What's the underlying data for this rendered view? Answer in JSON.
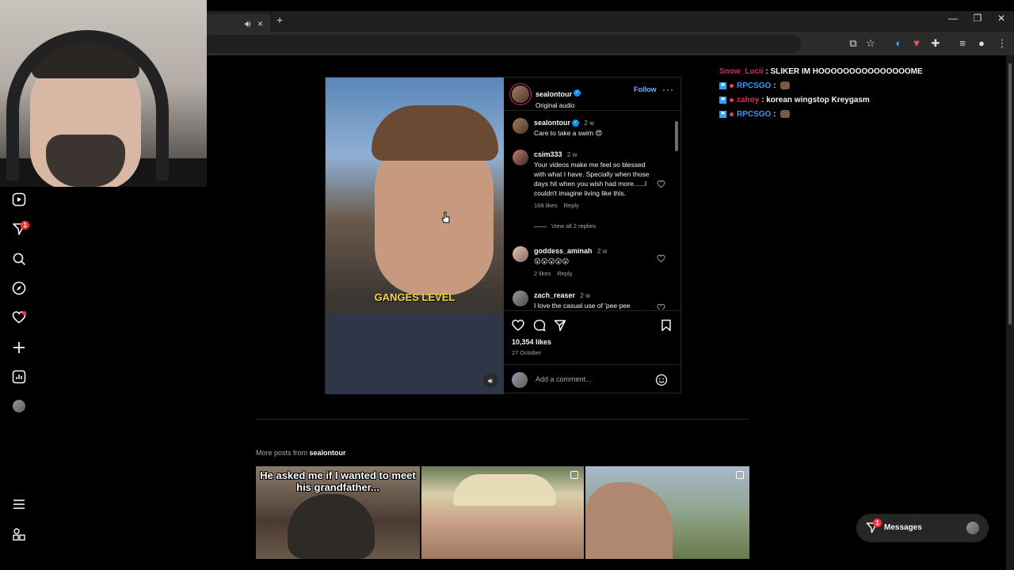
{
  "browser": {
    "new_tab": "+",
    "tab_close": "×",
    "window_controls": {
      "minimize": "—",
      "restore": "❐",
      "close": "✕"
    }
  },
  "post": {
    "username": "sealontour",
    "audio": "Original audio",
    "follow_label": "Follow",
    "video_caption": "GANGES LEVEL",
    "likes": "10,354 likes",
    "date": "27 October",
    "add_comment_placeholder": "Add a comment...",
    "comments": [
      {
        "user": "sealontour",
        "age": "2 w",
        "text": "Care to take a swim 😍",
        "verified": true
      },
      {
        "user": "csim333",
        "age": "2 w",
        "text": "Your videos make me feel so blessed with what I have. Specially when those days hit when you wish had more......I couldn't imagine living like this.",
        "likes": "168 likes",
        "reply": "Reply",
        "view_replies": "View all 2 replies"
      },
      {
        "user": "goddess_aminah",
        "age": "2 w",
        "text": "😮😮😮😮😮",
        "likes": "2 likes",
        "reply": "Reply"
      },
      {
        "user": "zach_reaser",
        "age": "2 w",
        "text": "I love the casual use of 'pee pee"
      }
    ]
  },
  "chat": [
    {
      "user": "Snow_Lucii",
      "user_color": "#e0245e",
      "message": "SLIKER IM HOOOOOOOOOOOOOOOME",
      "badges": false
    },
    {
      "user": "RPCSGO",
      "user_color": "#2e9bff",
      "message": "",
      "badges": true,
      "emote": true
    },
    {
      "user": "zahoy",
      "user_color": "#e0245e",
      "message": "korean wingstop Kreygasm",
      "badges": true
    },
    {
      "user": "RPCSGO",
      "user_color": "#2e9bff",
      "message": "",
      "badges": true,
      "emote": true
    }
  ],
  "more_posts": {
    "prefix": "More posts from ",
    "user": "sealontour",
    "thumb1_title": "He asked me if I wanted to meet his grandfather..."
  },
  "sidebar": {
    "notifications_badge": "1"
  },
  "messages": {
    "label": "Messages",
    "badge": "1"
  },
  "colors": {
    "accent": "#0095f6",
    "follow": "#69b4ff",
    "badge": "#ff3040",
    "caption_yellow": "#f5d443"
  }
}
